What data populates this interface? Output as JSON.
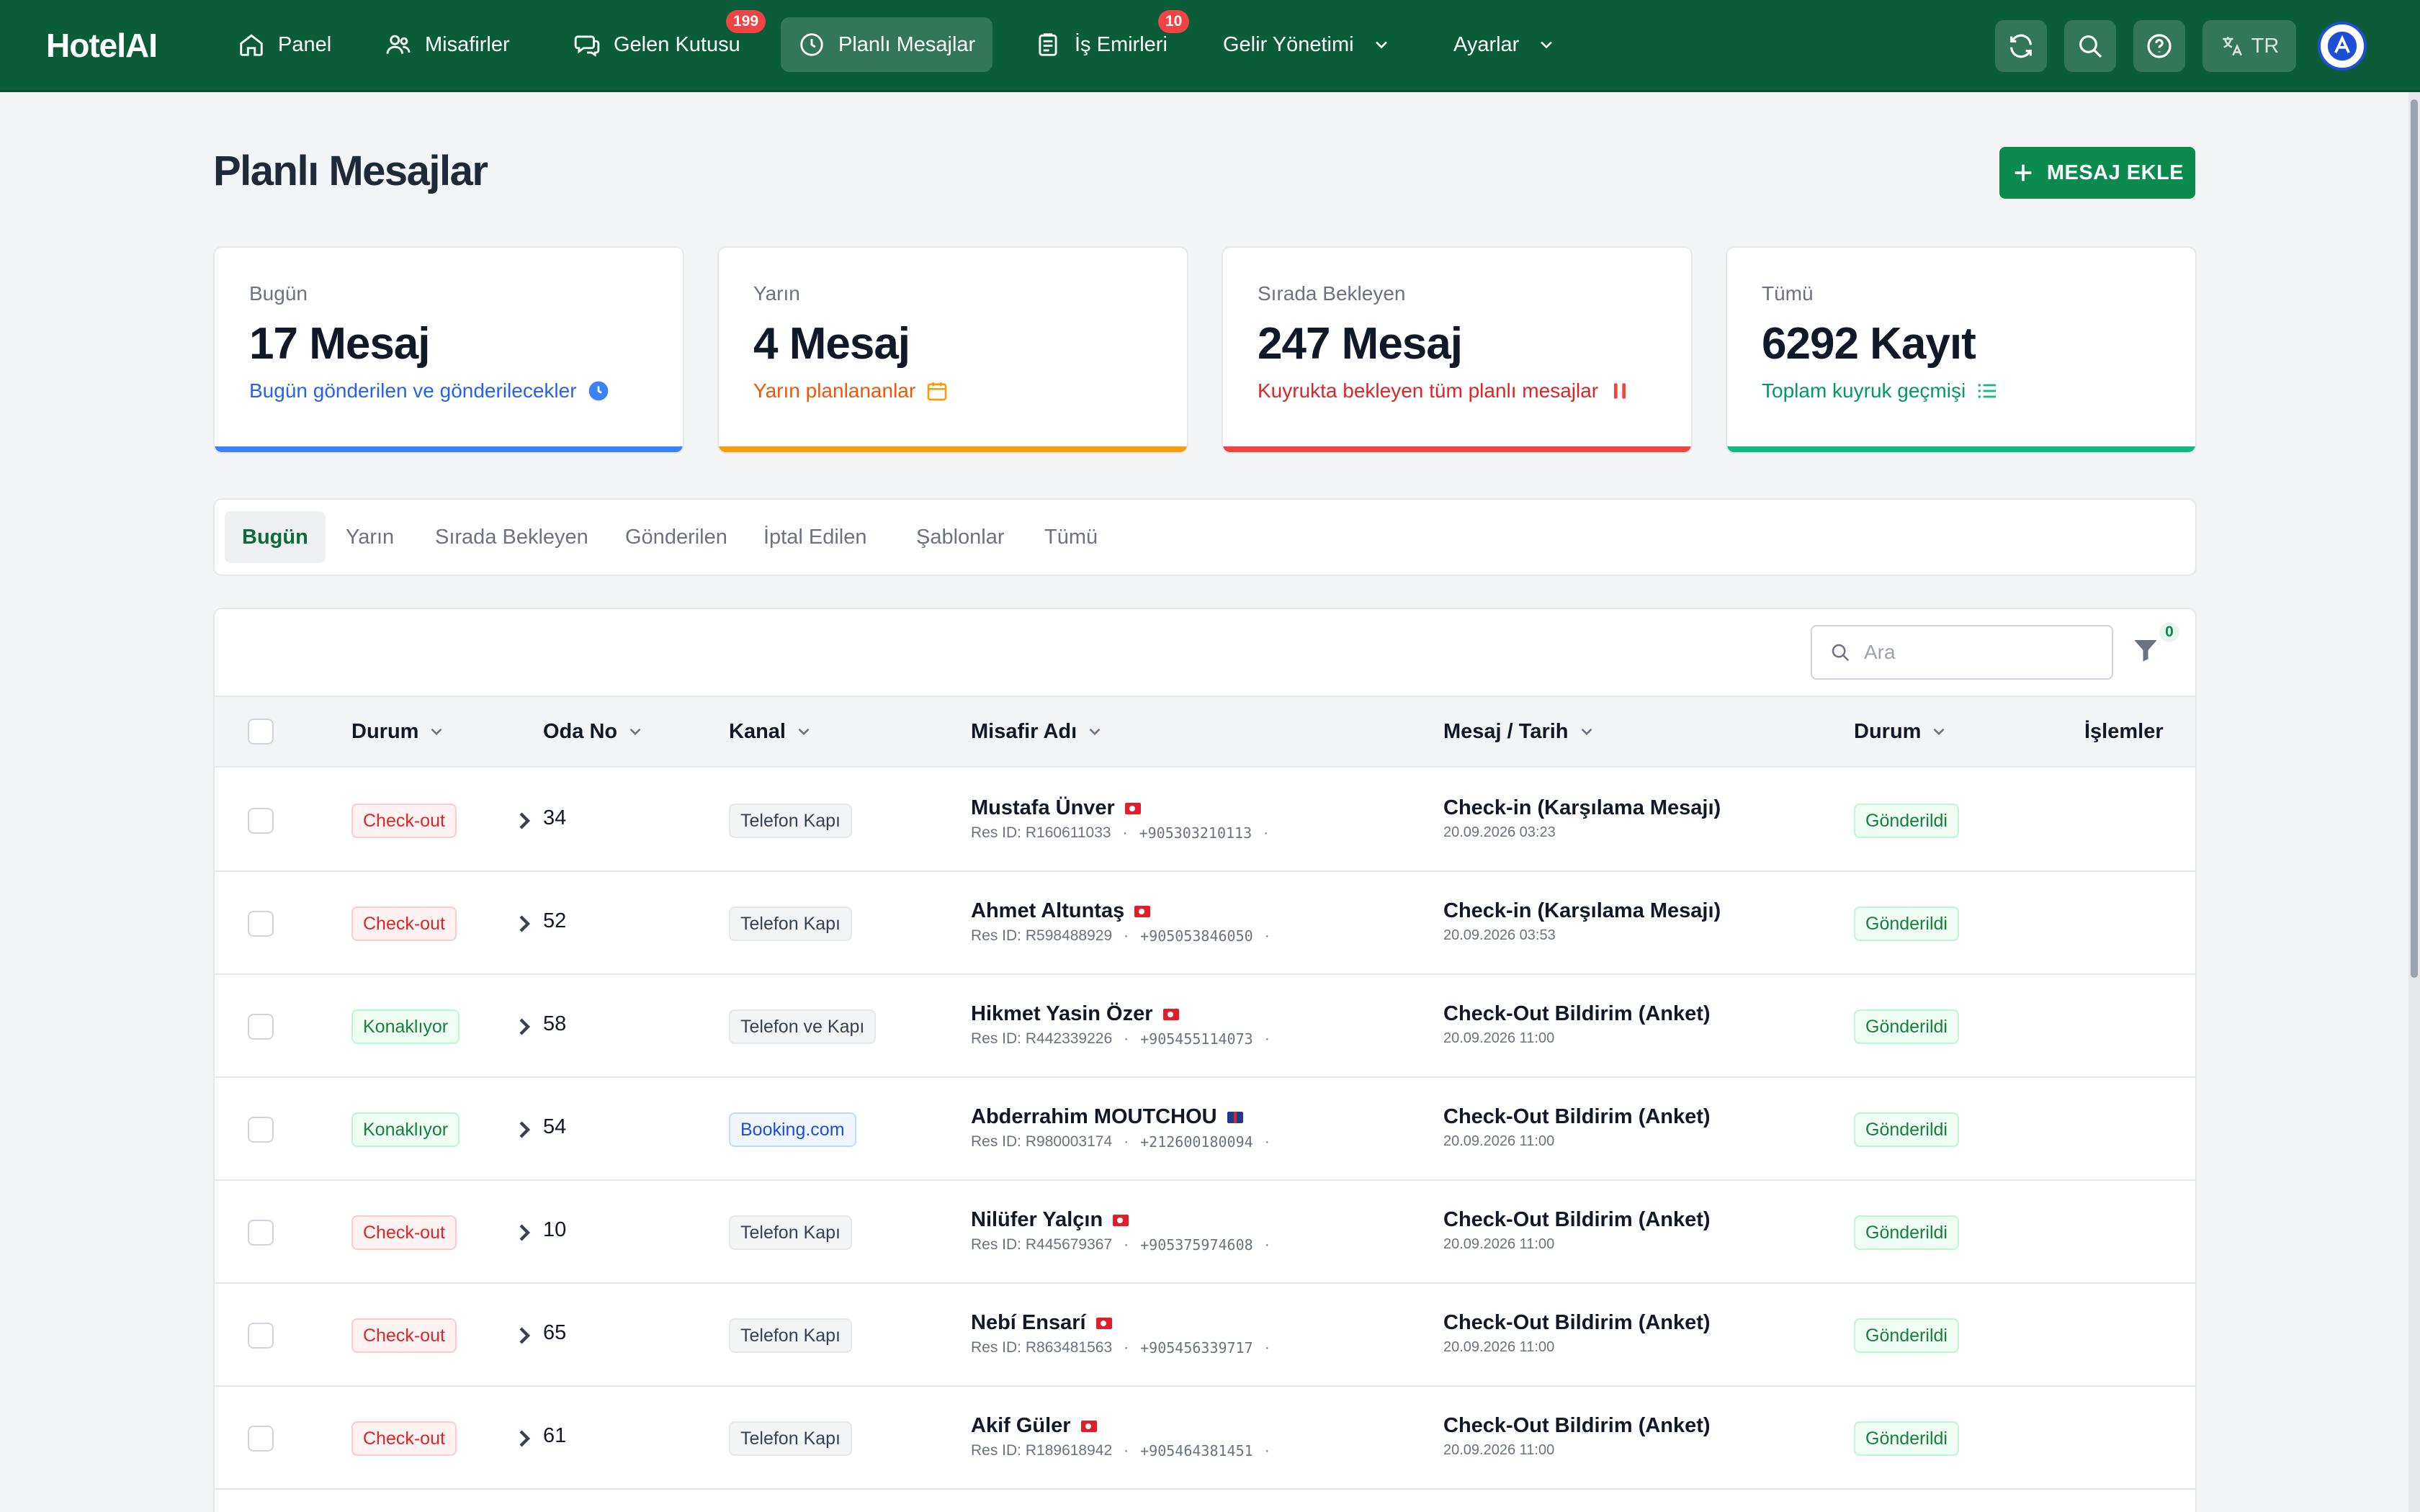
{
  "nav": {
    "brand": "HotelAI",
    "items": [
      {
        "label": "Panel",
        "icon": "home-icon"
      },
      {
        "label": "Misafirler",
        "icon": "users-icon"
      },
      {
        "label": "Gelen Kutusu",
        "icon": "chat-icon",
        "badge": "199"
      },
      {
        "label": "Planlı Mesajlar",
        "icon": "clock-icon",
        "active": true
      },
      {
        "label": "İş Emirleri",
        "icon": "clipboard-icon",
        "badge": "10"
      },
      {
        "label": "Gelir Yönetimi",
        "dropdown": true
      },
      {
        "label": "Ayarlar",
        "dropdown": true
      }
    ],
    "lang": "TR"
  },
  "page": {
    "title": "Planlı Mesajlar",
    "add_button": "MESAJ EKLE"
  },
  "stats": [
    {
      "label": "Bugün",
      "value": "17 Mesaj",
      "sub": "Bugün gönderilen ve gönderilecekler",
      "color": "#3b82f6"
    },
    {
      "label": "Yarın",
      "value": "4 Mesaj",
      "sub": "Yarın planlananlar",
      "color": "#f59e0b"
    },
    {
      "label": "Sırada Bekleyen",
      "value": "247 Mesaj",
      "sub": "Kuyrukta bekleyen tüm planlı mesajlar",
      "color": "#ef4444"
    },
    {
      "label": "Tümü",
      "value": "6292 Kayıt",
      "sub": "Toplam kuyruk geçmişi",
      "color": "#10b981"
    }
  ],
  "tabs": [
    "Bugün",
    "Yarın",
    "Sırada Bekleyen",
    "Gönderilen",
    "İptal Edilen",
    "Şablonlar",
    "Tümü"
  ],
  "table": {
    "search_placeholder": "Ara",
    "filter_count": "0",
    "columns": [
      "Durum",
      "Oda No",
      "Kanal",
      "Misafir Adı",
      "Mesaj / Tarih",
      "Durum",
      "İşlemler"
    ],
    "res_prefix": "Res ID:",
    "rows": [
      {
        "status": "Check-out",
        "room": "34",
        "channel": "Telefon Kapı",
        "guest": "Mustafa Ünver",
        "flag": "tr",
        "res_id": "R160611033",
        "phone": "+905303210113",
        "message": "Check-in (Karşılama Mesajı)",
        "date": "20.09.2026 03:23",
        "state": "Gönderildi"
      },
      {
        "status": "Check-out",
        "room": "52",
        "channel": "Telefon Kapı",
        "guest": "Ahmet Altuntaş",
        "flag": "tr",
        "res_id": "R598488929",
        "phone": "+905053846050",
        "message": "Check-in (Karşılama Mesajı)",
        "date": "20.09.2026 03:53",
        "state": "Gönderildi"
      },
      {
        "status": "Konaklıyor",
        "room": "58",
        "channel": "Telefon ve Kapı",
        "guest": "Hikmet Yasin Özer",
        "flag": "tr",
        "res_id": "R442339226",
        "phone": "+905455114073",
        "message": "Check-Out Bildirim (Anket)",
        "date": "20.09.2026 11:00",
        "state": "Gönderildi"
      },
      {
        "status": "Konaklıyor",
        "room": "54",
        "channel": "Booking.com",
        "guest": "Abderrahim MOUTCHOU",
        "flag": "gb",
        "res_id": "R980003174",
        "phone": "+212600180094",
        "message": "Check-Out Bildirim (Anket)",
        "date": "20.09.2026 11:00",
        "state": "Gönderildi"
      },
      {
        "status": "Check-out",
        "room": "10",
        "channel": "Telefon Kapı",
        "guest": "Nilüfer Yalçın",
        "flag": "tr",
        "res_id": "R445679367",
        "phone": "+905375974608",
        "message": "Check-Out Bildirim (Anket)",
        "date": "20.09.2026 11:00",
        "state": "Gönderildi"
      },
      {
        "status": "Check-out",
        "room": "65",
        "channel": "Telefon Kapı",
        "guest": "Nebí Ensarí",
        "flag": "tr",
        "res_id": "R863481563",
        "phone": "+905456339717",
        "message": "Check-Out Bildirim (Anket)",
        "date": "20.09.2026 11:00",
        "state": "Gönderildi"
      },
      {
        "status": "Check-out",
        "room": "61",
        "channel": "Telefon Kapı",
        "guest": "Akif Güler",
        "flag": "tr",
        "res_id": "R189618942",
        "phone": "+905464381451",
        "message": "Check-Out Bildirim (Anket)",
        "date": "20.09.2026 11:00",
        "state": "Gönderildi"
      }
    ]
  }
}
